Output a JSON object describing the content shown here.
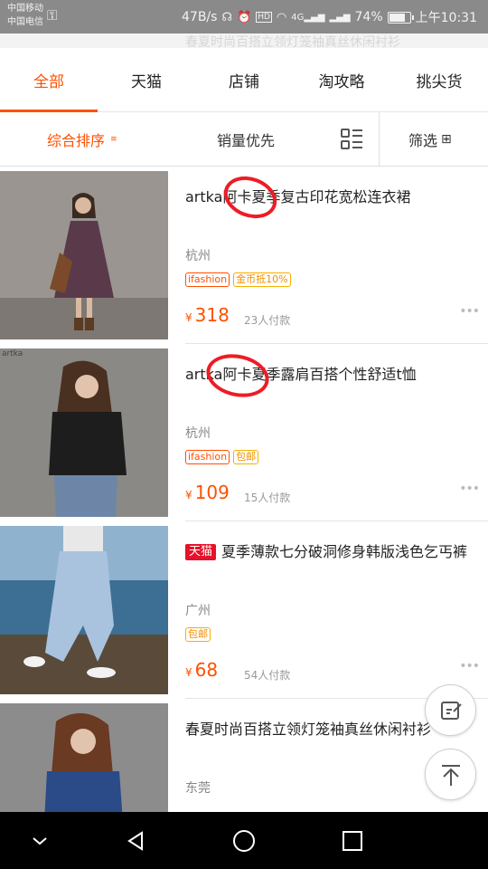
{
  "status_bar": {
    "carrier_line1": "中国移动",
    "carrier_line2": "中国电信",
    "net_speed": "47B/s",
    "network_type": "4G",
    "battery_percent": "74%",
    "battery_level": 0.74,
    "time": "上午10:31"
  },
  "ghost_header": "春夏时尚百搭立领灯笼袖真丝休闲衬衫",
  "tabs": [
    {
      "label": "全部",
      "active": true
    },
    {
      "label": "天猫",
      "active": false
    },
    {
      "label": "店铺",
      "active": false
    },
    {
      "label": "淘攻略",
      "active": false
    },
    {
      "label": "挑尖货",
      "active": false
    }
  ],
  "sort": {
    "default_label": "综合排序",
    "sales_label": "销量优先",
    "filter_label": "筛选"
  },
  "products": [
    {
      "title": "artka阿卡夏季复古印花宽松连衣裙",
      "tmall": false,
      "city": "杭州",
      "badges": [
        {
          "text": "ifashion",
          "style": "red"
        },
        {
          "text": "金币抵10%",
          "style": "yellow"
        }
      ],
      "currency": "¥",
      "price": "318",
      "sold": "23人付款"
    },
    {
      "title": "artka阿卡夏季露肩百搭个性舒适t恤",
      "tmall": false,
      "thumb_label": "artka",
      "city": "杭州",
      "badges": [
        {
          "text": "ifashion",
          "style": "red"
        },
        {
          "text": "包邮",
          "style": "yellow"
        }
      ],
      "currency": "¥",
      "price": "109",
      "sold": "15人付款"
    },
    {
      "title": "夏季薄款七分破洞修身韩版浅色乞丐裤",
      "tmall": true,
      "tmall_label": "天猫",
      "city": "广州",
      "badges": [
        {
          "text": "包邮",
          "style": "yellow"
        }
      ],
      "currency": "¥",
      "price": "68",
      "sold": "54人付款"
    },
    {
      "title": "春夏时尚百搭立领灯笼袖真丝休闲衬衫",
      "tmall": false,
      "city": "东莞",
      "badges": []
    }
  ],
  "colors": {
    "accent": "#ff5000",
    "tmall_red": "#e4122a",
    "annotation_red": "#ee1c25"
  }
}
